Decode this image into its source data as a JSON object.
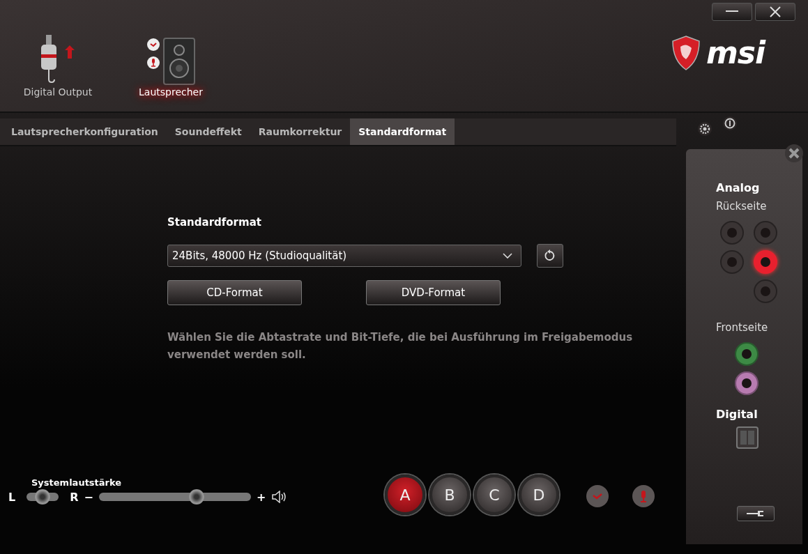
{
  "devices": [
    {
      "label": "Digital Output",
      "kind": "plug",
      "selected": false
    },
    {
      "label": "Lautsprecher",
      "kind": "speaker",
      "selected": true
    }
  ],
  "logo": {
    "text": "msi"
  },
  "tabs": [
    {
      "label": "Lautsprecherkonfiguration",
      "selected": false
    },
    {
      "label": "Soundeffekt",
      "selected": false
    },
    {
      "label": "Raumkorrektur",
      "selected": false
    },
    {
      "label": "Standardformat",
      "selected": true
    }
  ],
  "format": {
    "heading": "Standardformat",
    "value": "24Bits, 48000 Hz (Studioqualität)",
    "buttons": [
      "CD-Format",
      "DVD-Format"
    ],
    "description": "Wählen Sie die Abtastrate und Bit-Tiefe, die bei Ausführung im Freigabemodus verwendet werden soll."
  },
  "volume": {
    "label": "Systemlautstärke",
    "left": "L",
    "right": "R",
    "minus": "−",
    "plus": "+",
    "balance": {
      "level": 0.5
    },
    "master": {
      "level": 0.66
    }
  },
  "profiles": [
    {
      "label": "A",
      "selected": true
    },
    {
      "label": "B",
      "selected": false
    },
    {
      "label": "C",
      "selected": false
    },
    {
      "label": "D",
      "selected": false
    }
  ],
  "panel": {
    "heading": "Analog",
    "rear_label": "Rückseite",
    "rear": [
      {
        "color": "#3a3434",
        "plugged": false
      },
      {
        "color": "#3a3434",
        "plugged": false
      },
      {
        "color": "#3a3434",
        "plugged": false
      },
      {
        "color": "#e8202e",
        "plugged": true
      },
      {
        "color": "#3a3434",
        "plugged": false
      }
    ],
    "front_label": "Frontseite",
    "front": [
      {
        "color": "#3d8a45",
        "plugged": false
      },
      {
        "color": "#b77bb0",
        "plugged": false
      }
    ],
    "digital_label": "Digital"
  }
}
